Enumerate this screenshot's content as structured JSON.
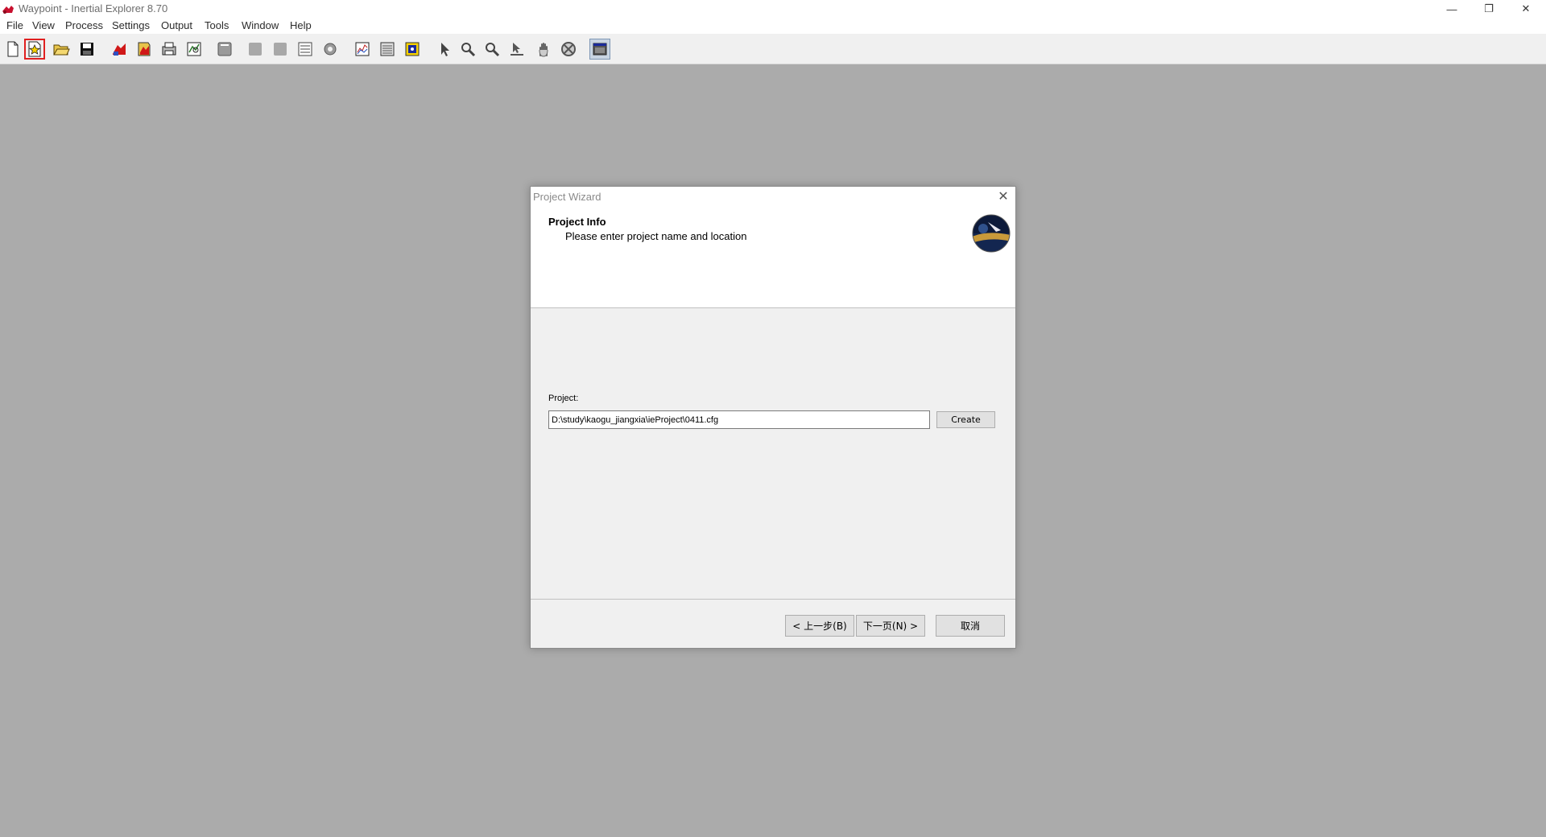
{
  "window": {
    "title": "Waypoint - Inertial Explorer 8.70",
    "controls": {
      "minimize": "—",
      "restore": "❐",
      "close": "✕"
    }
  },
  "menu": [
    "File",
    "View",
    "Process",
    "Settings",
    "Output",
    "Tools",
    "Window",
    "Help"
  ],
  "toolbar": {
    "icons": [
      "new-file-icon",
      "new-project-wizard-icon",
      "open-folder-icon",
      "save-icon",
      "gnss-process-icon",
      "ins-process-icon",
      "combine-icon",
      "data-view-icon",
      "display-icon",
      "disabled-icon",
      "disabled-icon",
      "list-icon",
      "gear-icon",
      "plot-icon",
      "results-icon",
      "export-icon",
      "pointer-icon",
      "zoom-in-icon",
      "zoom-out-icon",
      "measure-icon",
      "pan-hand-icon",
      "zoom-extents-icon",
      "map-window-icon"
    ],
    "highlight_color": "#e02020"
  },
  "dialog": {
    "title": "Project Wizard",
    "close": "✕",
    "header_title": "Project Info",
    "header_subtitle": "Please enter project name and location",
    "project_label": "Project:",
    "project_value": "D:\\study\\kaogu_jiangxia\\ieProject\\0411.cfg",
    "create_label": "Create",
    "back_label": "< 上一步(B)",
    "next_label": "下一页(N) >",
    "cancel_label": "取消"
  },
  "colors": {
    "workspace": "#ababab",
    "toolbar": "#f0f0f0",
    "dialog_body": "#f0f0f0"
  }
}
